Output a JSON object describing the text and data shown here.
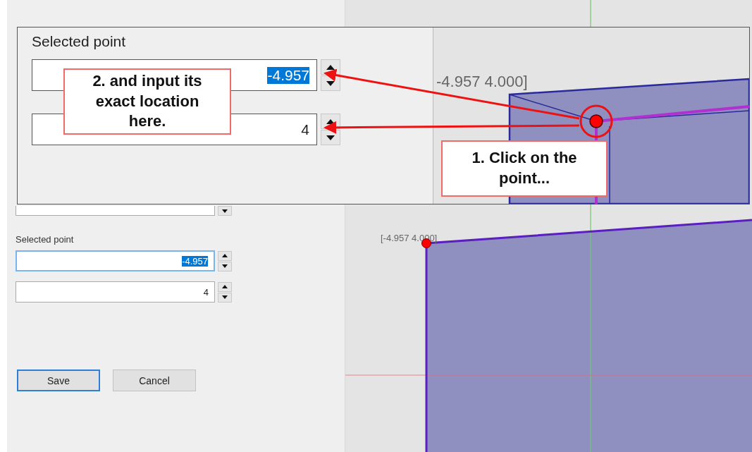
{
  "inset": {
    "label": "Selected point",
    "fields": [
      {
        "value": "-4.957",
        "selected": true
      },
      {
        "value": "4",
        "selected": false
      }
    ],
    "coordinate_label": "-4.957 4.000]"
  },
  "callouts": [
    {
      "text": "2. and input its exact location here."
    },
    {
      "text": "1. Click on the point..."
    }
  ],
  "panel": {
    "label": "Selected point",
    "fields": [
      {
        "value": "-4.957",
        "selected": true,
        "focused": true
      },
      {
        "value": "4",
        "selected": false,
        "focused": false
      }
    ],
    "buttons": [
      {
        "label": "Save",
        "default": true
      },
      {
        "label": "Cancel",
        "default": false
      }
    ]
  },
  "canvas": {
    "coordinate_label": "[-4.957 4.000]"
  }
}
